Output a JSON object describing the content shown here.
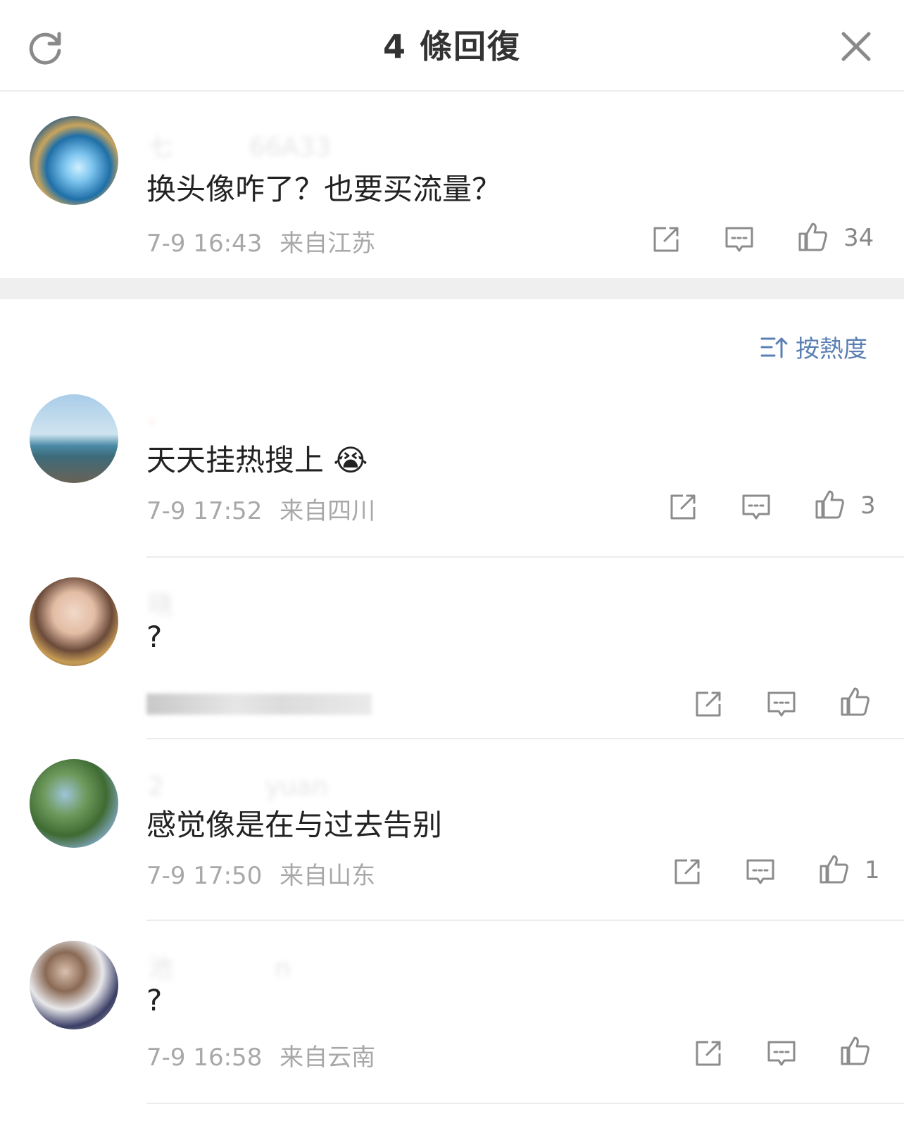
{
  "header": {
    "title": "4 條回復",
    "refresh_icon": "refresh-icon",
    "close_icon": "close-icon"
  },
  "main_comment": {
    "username": "七　　　66A33",
    "text": "换头像咋了？也要买流量？",
    "time": "7-9 16:43",
    "location": "来自江苏",
    "likes": "34"
  },
  "sort": {
    "label": "按熱度",
    "icon": "sort-icon"
  },
  "replies": [
    {
      "username": "·　　　　",
      "text": "天天挂热搜上",
      "emoji": "😭",
      "time": "7-9 17:52",
      "location": "来自四川",
      "likes": "3"
    },
    {
      "username": "晓　　　　　",
      "text": "?",
      "time": "",
      "location": "",
      "likes": ""
    },
    {
      "username": "2　　　　yuan",
      "text": "感觉像是在与过去告别",
      "time": "7-9 17:50",
      "location": "来自山东",
      "likes": "1"
    },
    {
      "username": "池　　　　n",
      "text": "?",
      "time": "7-9 16:58",
      "location": "来自云南",
      "likes": ""
    }
  ],
  "colors": {
    "accent_blue": "#5b7fb4",
    "meta_gray": "#a8a8a8",
    "icon_gray": "#8c8c8c"
  }
}
